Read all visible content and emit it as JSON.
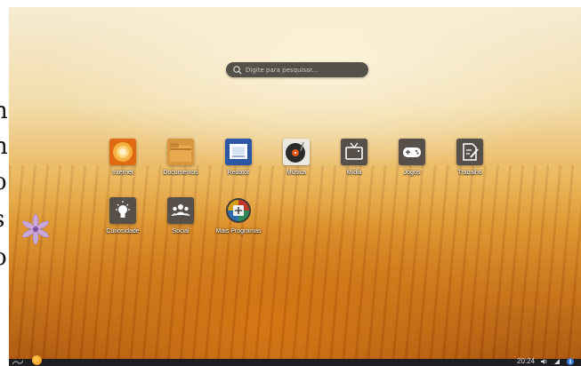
{
  "search": {
    "placeholder": "Digite para pesquisar..."
  },
  "apps": [
    {
      "label": "Internet"
    },
    {
      "label": "Documentos"
    },
    {
      "label": "Redator"
    },
    {
      "label": "Música"
    },
    {
      "label": "Mídia"
    },
    {
      "label": "Jogos"
    },
    {
      "label": "Trabalho"
    },
    {
      "label": "Curiosidade"
    },
    {
      "label": "Social"
    },
    {
      "label": "Mais Programas"
    }
  ],
  "taskbar": {
    "time": "20:24"
  },
  "colors": {
    "accent": "#f08a10",
    "taskbar": "#1e1d22",
    "search_bg": "#555048"
  }
}
